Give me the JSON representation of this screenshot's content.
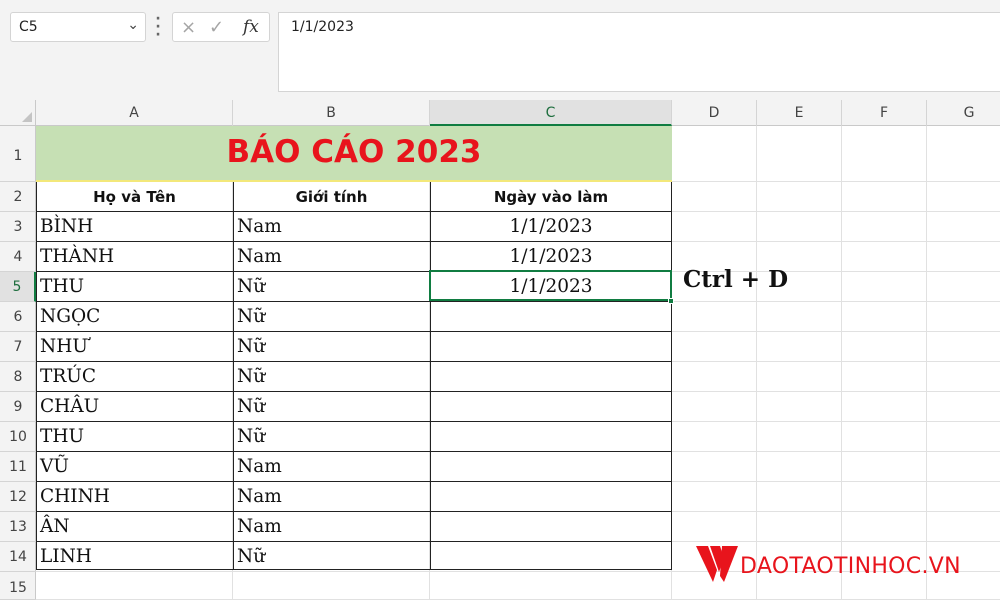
{
  "formula_bar": {
    "name_box": "C5",
    "cancel_icon": "×",
    "enter_icon": "✓",
    "fx_label": "fx",
    "value": "1/1/2023"
  },
  "columns": [
    "A",
    "B",
    "C",
    "D",
    "E",
    "F",
    "G"
  ],
  "rows": [
    "1",
    "2",
    "3",
    "4",
    "5",
    "6",
    "7",
    "8",
    "9",
    "10",
    "11",
    "12",
    "13",
    "14",
    "15"
  ],
  "selected_cell": {
    "column": "C",
    "row": "5"
  },
  "sheet": {
    "title": "BÁO CÁO 2023",
    "headers": [
      "Họ và Tên",
      "Giới tính",
      "Ngày vào làm"
    ],
    "records": [
      {
        "name": "BÌNH",
        "gender": "Nam",
        "date": "1/1/2023"
      },
      {
        "name": "THÀNH",
        "gender": "Nam",
        "date": "1/1/2023"
      },
      {
        "name": "THU",
        "gender": "Nữ",
        "date": "1/1/2023"
      },
      {
        "name": "NGỌC",
        "gender": "Nữ",
        "date": ""
      },
      {
        "name": "NHƯ",
        "gender": "Nữ",
        "date": ""
      },
      {
        "name": "TRÚC",
        "gender": "Nữ",
        "date": ""
      },
      {
        "name": "CHÂU",
        "gender": "Nữ",
        "date": ""
      },
      {
        "name": "THU",
        "gender": "Nữ",
        "date": ""
      },
      {
        "name": "VŨ",
        "gender": "Nam",
        "date": ""
      },
      {
        "name": "CHINH",
        "gender": "Nam",
        "date": ""
      },
      {
        "name": "ÂN",
        "gender": "Nam",
        "date": ""
      },
      {
        "name": "LINH",
        "gender": "Nữ",
        "date": ""
      }
    ]
  },
  "annotation": "Ctrl + D",
  "watermark": "DAOTAOTINHOC.VN",
  "colors": {
    "accent_green": "#107c41",
    "title_fill": "#c6e0b4",
    "title_text": "#e8141c",
    "brand_red": "#e8141c"
  }
}
